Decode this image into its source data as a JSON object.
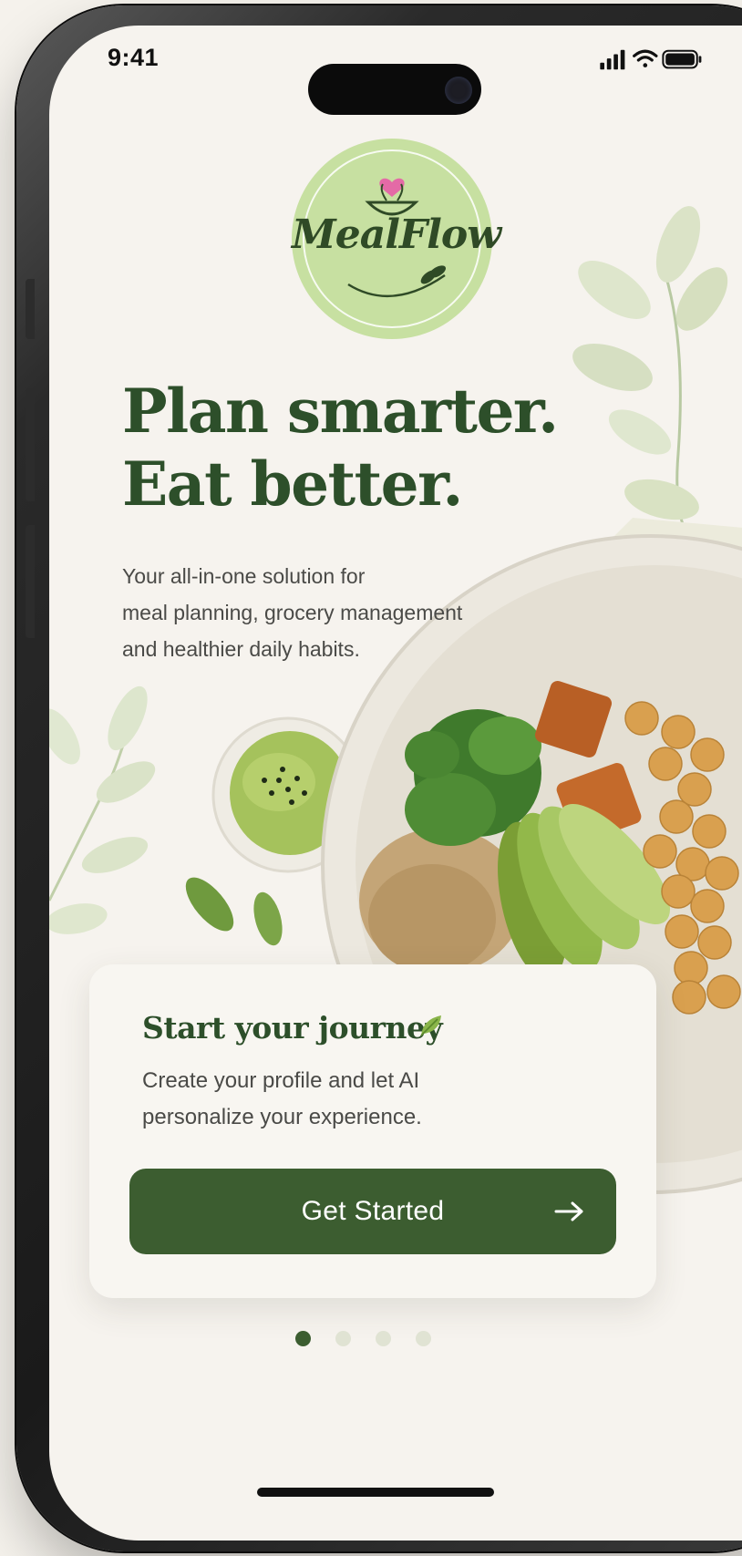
{
  "status_bar": {
    "time": "9:41",
    "icons": [
      "signal-icon",
      "wifi-icon",
      "battery-icon"
    ]
  },
  "logo": {
    "text": "MealFlow"
  },
  "hero": {
    "headline_line1": "Plan smarter.",
    "headline_line2": "Eat better.",
    "subtitle_line1": "Your all-in-one solution for",
    "subtitle_line2": "meal planning, grocery management",
    "subtitle_line3": "and healthier daily habits."
  },
  "card": {
    "title": "Start your journey",
    "title_icon": "leaf-icon",
    "text_line1": "Create your profile and let AI",
    "text_line2": "personalize your experience.",
    "button_label": "Get Started",
    "button_icon": "arrow-right-icon"
  },
  "pagination": {
    "total": 4,
    "active_index": 0
  },
  "colors": {
    "primary": "#3c5d30",
    "headline": "#2d4f2a",
    "background": "#f6f3ee",
    "logo_bg": "#c7e0a1",
    "dot_inactive": "#e0e3d3"
  }
}
